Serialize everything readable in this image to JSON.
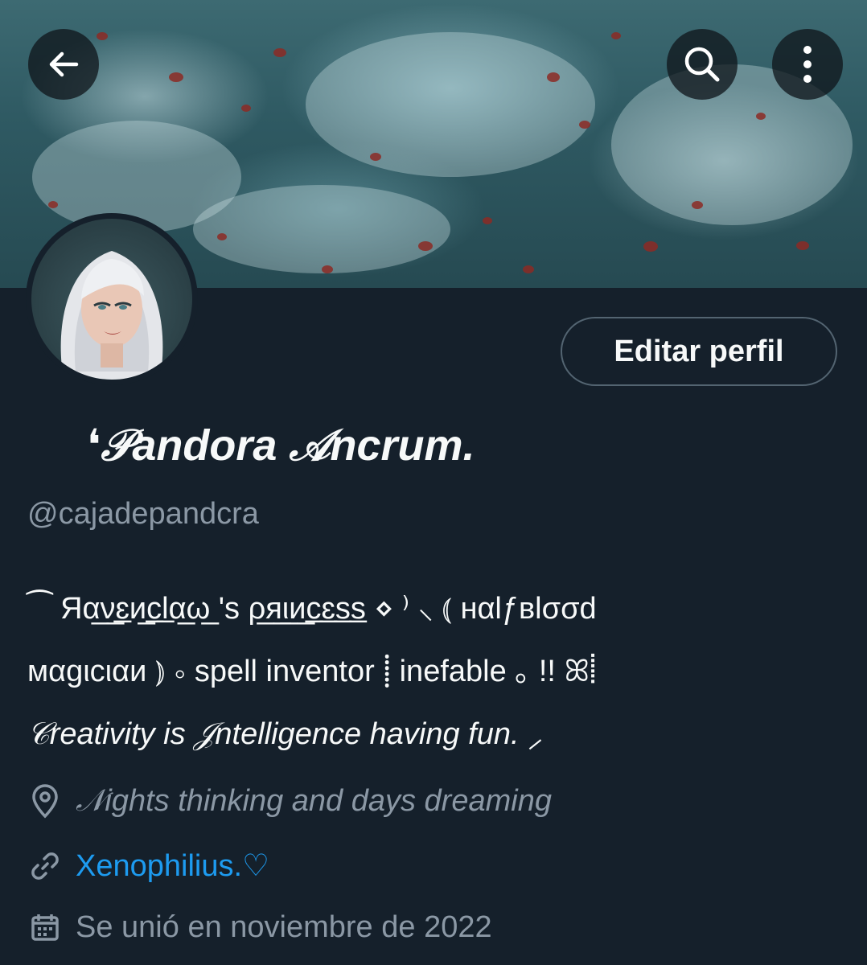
{
  "header": {
    "back_icon": "arrow-left-icon",
    "search_icon": "search-icon",
    "more_icon": "more-vertical-icon"
  },
  "profile": {
    "edit_button_label": "Editar perfil",
    "display_name": "❛𝒫andora 𝒜ncrum.",
    "handle": "@cajadepandcra",
    "bio_lines": [
      "          ⁀ Яα̲ν̲ɛ̲и̲c̲l̲α̲ω̲ 's ρ̲я̲ι̲и̲c̲ɛ̲s̲s̲ ⋄ ⁾ ⸜ ⦅ нαlƒвlσσd",
      "мαgιcιαи ⦆  ⸰ spell inventor ⸽ inefable ｡ !! ꕤ⸽",
      "𝒞reativity is 𝒥ntelligence having fun. ⸝"
    ],
    "location": "        𝒩ights thinking and days dreaming",
    "website": "Xenophilius.♡",
    "joined": "Se unió en noviembre de 2022"
  },
  "colors": {
    "background": "#15202b",
    "primary_text": "#f7f9f9",
    "secondary_text": "#8b98a5",
    "link": "#1d9bf0",
    "border": "#536471"
  }
}
